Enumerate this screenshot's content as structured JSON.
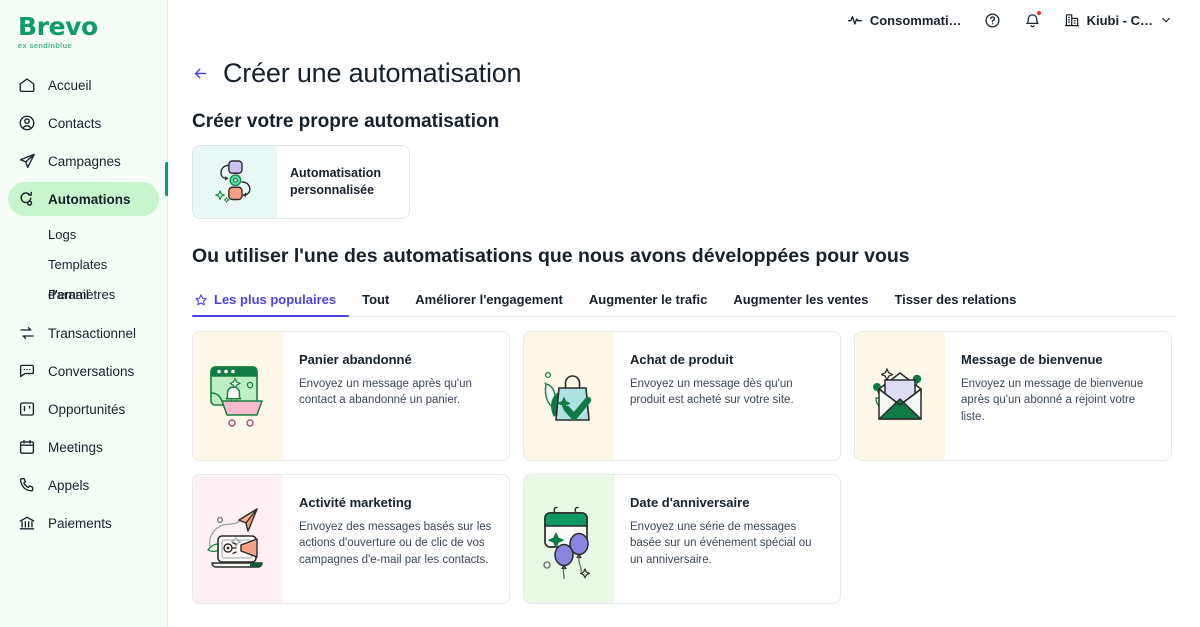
{
  "brand": {
    "name": "Brevo",
    "tagline": "ex sendinblue",
    "color": "#0D9B6C"
  },
  "sidebar": {
    "items": [
      {
        "label": "Accueil",
        "icon": "home-icon"
      },
      {
        "label": "Contacts",
        "icon": "user-circle-icon"
      },
      {
        "label": "Campagnes",
        "icon": "paper-plane-icon"
      },
      {
        "label": "Automations",
        "icon": "automation-icon",
        "active": true
      },
      {
        "label": "Transactionnel",
        "icon": "transfer-icon"
      },
      {
        "label": "Conversations",
        "icon": "chat-icon"
      },
      {
        "label": "Opportunités",
        "icon": "board-icon"
      },
      {
        "label": "Meetings",
        "icon": "calendar-icon"
      },
      {
        "label": "Appels",
        "icon": "phone-icon"
      },
      {
        "label": "Paiements",
        "icon": "bank-icon"
      }
    ],
    "sub_items": [
      {
        "label": "Logs"
      },
      {
        "label": "Templates d'email"
      },
      {
        "label": "Paramètres"
      }
    ]
  },
  "topbar": {
    "usage_label": "Consommati…",
    "usage_icon": "pulse-icon",
    "help_icon": "help-circle-icon",
    "notifications_icon": "bell-icon",
    "account_icon": "building-icon",
    "account_label": "Kiubi - C…",
    "chevron_icon": "chevron-down-icon",
    "notification_dot_color": "#F7282A"
  },
  "page": {
    "back_icon": "arrow-left-icon",
    "title": "Créer une automatisation",
    "section_custom_title": "Créer votre propre automatisation",
    "section_templates_title": "Ou utiliser l'une des automatisations que nous avons développées pour vous"
  },
  "custom_card": {
    "line1": "Automatisation",
    "line2": "personnalisée",
    "art": "custom-automation-illustration",
    "bg": "#E9F8F6"
  },
  "tabs": [
    {
      "label": "Les plus populaires",
      "icon": "star-icon",
      "active": true
    },
    {
      "label": "Tout",
      "active": false
    },
    {
      "label": "Améliorer l'engagement",
      "active": false
    },
    {
      "label": "Augmenter le trafic",
      "active": false
    },
    {
      "label": "Augmenter les ventes",
      "active": false
    },
    {
      "label": "Tisser des relations",
      "active": false
    }
  ],
  "templates": [
    {
      "title": "Panier abandonné",
      "desc": "Envoyez un message après qu'un contact a abandonné un panier.",
      "art": "abandoned-cart-illustration",
      "bg": "#FDF8E7"
    },
    {
      "title": "Achat de produit",
      "desc": "Envoyez un message dès qu'un produit est acheté sur votre site.",
      "art": "product-purchase-illustration",
      "bg": "#FDF8E7"
    },
    {
      "title": "Message de bienvenue",
      "desc": "Envoyez un message de bienvenue après qu'un abonné a rejoint votre liste.",
      "art": "welcome-message-illustration",
      "bg": "#FDF8E7"
    },
    {
      "title": "Activité marketing",
      "desc": "Envoyez des messages basés sur les actions d'ouverture ou de clic de vos campagnes d'e-mail par les contacts.",
      "art": "marketing-activity-illustration",
      "bg": "#FCF0F5"
    },
    {
      "title": "Date d'anniversaire",
      "desc": "Envoyez une série de messages basée sur un événement spécial ou un anniversaire.",
      "art": "birthday-illustration",
      "bg": "#E9F7E5"
    }
  ],
  "accent": {
    "purple": "#4B42E8",
    "green": "#0B996E",
    "active_pill": "#C9F5CC"
  }
}
